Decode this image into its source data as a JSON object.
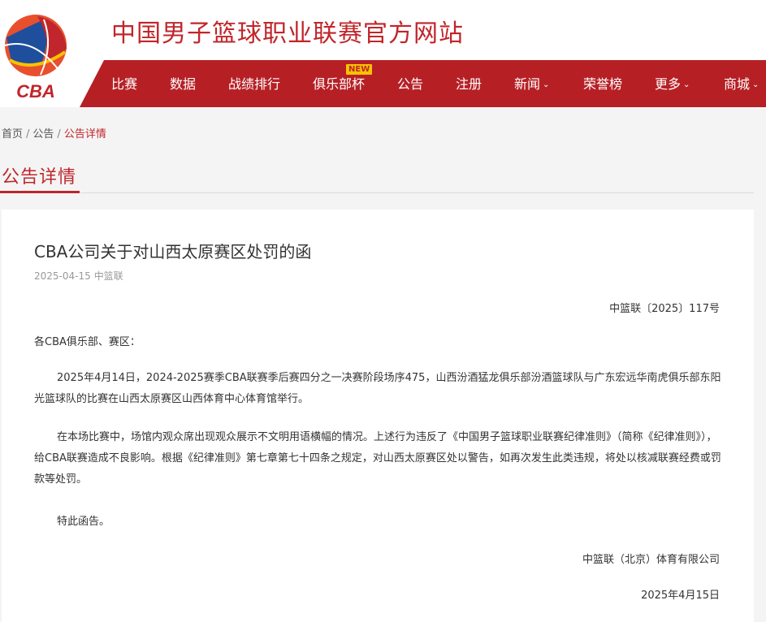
{
  "site": {
    "logo_text": "CBA",
    "title": "中国男子篮球职业联赛官方网站"
  },
  "nav": {
    "items": [
      {
        "label": "比赛"
      },
      {
        "label": "数据"
      },
      {
        "label": "战绩排行"
      },
      {
        "label": "俱乐部杯"
      },
      {
        "label": "公告"
      },
      {
        "label": "注册"
      },
      {
        "label": "新闻"
      },
      {
        "label": "荣誉榜"
      },
      {
        "label": "更多"
      },
      {
        "label": "商城"
      }
    ],
    "new_badge": "NEW"
  },
  "breadcrumb": {
    "home": "首页",
    "parent": "公告",
    "current": "公告详情"
  },
  "section": {
    "title": "公告详情"
  },
  "article": {
    "title": "CBA公司关于对山西太原赛区处罚的函",
    "date": "2025-04-15",
    "source": "中篮联",
    "doc_number": "中篮联〔2025〕117号",
    "salutation": "各CBA俱乐部、赛区：",
    "paragraphs": [
      "2025年4月14日，2024-2025赛季CBA联赛季后赛四分之一决赛阶段场序475，山西汾酒猛龙俱乐部汾酒篮球队与广东宏远华南虎俱乐部东阳光篮球队的比赛在山西太原赛区山西体育中心体育馆举行。",
      "在本场比赛中，场馆内观众席出现观众展示不文明用语横幅的情况。上述行为违反了《中国男子篮球职业联赛纪律准则》（简称《纪律准则》），给CBA联赛造成不良影响。根据《纪律准则》第七章第七十四条之规定，对山西太原赛区处以警告，如再次发生此类违规，将处以核减联赛经费或罚款等处罚。",
      "特此函告。"
    ],
    "signature": "中篮联（北京）体育有限公司",
    "sign_date": "2025年4月15日"
  },
  "colors": {
    "brand_red": "#b62025",
    "title_red": "#c0262b",
    "badge_yellow": "#f6c300"
  }
}
